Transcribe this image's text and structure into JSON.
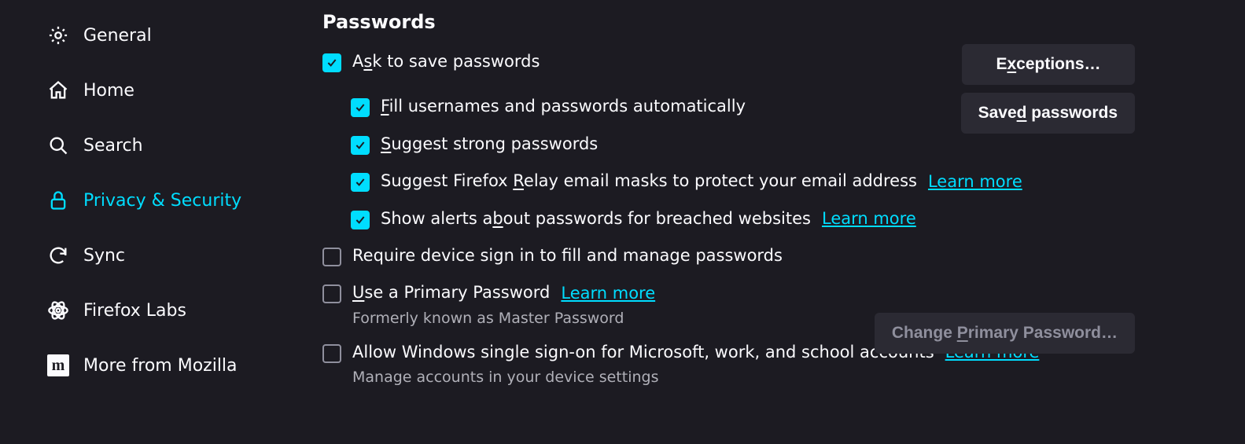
{
  "sidebar": {
    "items": [
      {
        "label": "General"
      },
      {
        "label": "Home"
      },
      {
        "label": "Search"
      },
      {
        "label": "Privacy & Security"
      },
      {
        "label": "Sync"
      },
      {
        "label": "Firefox Labs"
      },
      {
        "label": "More from Mozilla"
      }
    ]
  },
  "main": {
    "section_title": "Passwords",
    "ask_save": {
      "pre": "A",
      "u": "s",
      "post": "k to save passwords"
    },
    "fill_auto": {
      "u": "F",
      "post": "ill usernames and passwords automatically"
    },
    "suggest_strong": {
      "u": "S",
      "post": "uggest strong passwords"
    },
    "relay": {
      "pre": "Suggest Firefox ",
      "u": "R",
      "post": "elay email masks to protect your email address"
    },
    "breach": {
      "pre": "Show alerts a",
      "u": "b",
      "post": "out passwords for breached websites"
    },
    "require_signin": "Require device sign in to fill and manage passwords",
    "primary_pw": {
      "u": "U",
      "post": "se a Primary Password"
    },
    "primary_desc": "Formerly known as Master Password",
    "sso": "Allow Windows single sign-on for Microsoft, work, and school accounts",
    "sso_desc": "Manage accounts in your device settings",
    "learn_more": "Learn more",
    "btn_exceptions": {
      "pre": "E",
      "u": "x",
      "post": "ceptions…"
    },
    "btn_saved": {
      "pre": "Save",
      "u": "d",
      "post": " passwords"
    },
    "btn_change_primary": {
      "pre": "Change ",
      "u": "P",
      "post": "rimary Password…"
    }
  }
}
